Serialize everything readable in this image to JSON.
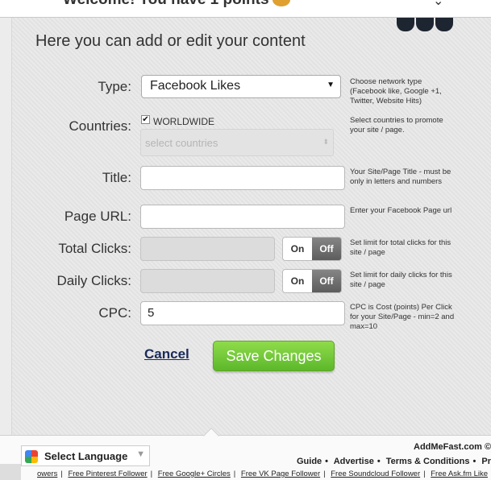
{
  "header": {
    "welcome_text": "Welcome! You have  1 points",
    "coin_icon": "coin-icon",
    "chevron_icon": "chevron-down-icon"
  },
  "form": {
    "heading": "Here you can add or edit your content",
    "type": {
      "label": "Type:",
      "selected": "Facebook Likes",
      "help": "Choose network type (Facebook like, Google +1, Twitter, Website Hits)"
    },
    "countries": {
      "label": "Countries:",
      "worldwide_label": "WORLDWIDE",
      "worldwide_checked": true,
      "select_placeholder": "select countries",
      "help": "Select countries to promote your site / page."
    },
    "title": {
      "label": "Title:",
      "value": "",
      "help": "Your Site/Page Title - must be only in letters and numbers"
    },
    "page_url": {
      "label": "Page URL:",
      "value": "",
      "help": "Enter your Facebook Page url"
    },
    "total_clicks": {
      "label": "Total Clicks:",
      "on_label": "On",
      "off_label": "Off",
      "help": "Set limit for total clicks for this site / page"
    },
    "daily_clicks": {
      "label": "Daily Clicks:",
      "on_label": "On",
      "off_label": "Off",
      "help": "Set limit for daily clicks for this site / page"
    },
    "cpc": {
      "label": "CPC:",
      "value": "5",
      "help": "CPC is Cost (points) Per Click for your Site/Page - min=2 and max=10"
    },
    "cancel_label": "Cancel",
    "save_label": "Save Changes"
  },
  "footer": {
    "language_label": "Select Language",
    "copyright": "AddMeFast.com ©",
    "nav": [
      "Guide",
      "Advertise",
      "Terms & Conditions",
      "Pr"
    ],
    "links": [
      "owers",
      "Free Pinterest Follower",
      "Free Google+ Circles",
      "Free VK Page Follower",
      "Free Soundcloud Follower",
      "Free Ask.fm Like"
    ]
  },
  "colors": {
    "save_green": "#6cc833",
    "toggle_off": "#6d6d6d",
    "cancel_link": "#1a2a5a"
  }
}
